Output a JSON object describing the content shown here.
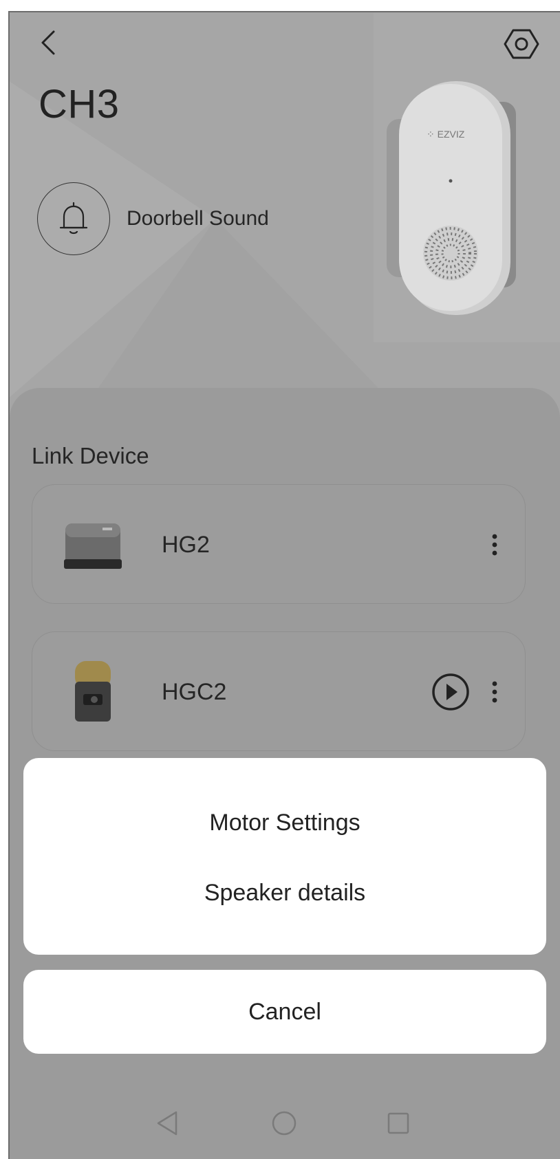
{
  "header": {
    "title": "CH3",
    "back_icon": "chevron-left-icon",
    "settings_icon": "hexagon-gear-icon"
  },
  "sound": {
    "label": "Doorbell Sound",
    "icon": "bell-icon"
  },
  "hero": {
    "brand_text": "EZVIZ"
  },
  "link_section": {
    "title": "Link Device",
    "devices": [
      {
        "name": "HG2",
        "has_play": false,
        "more_icon": "more-vertical-icon"
      },
      {
        "name": "HGC2",
        "has_play": true,
        "play_icon": "play-circle-icon",
        "more_icon": "more-vertical-icon"
      }
    ]
  },
  "action_sheet": {
    "items": [
      "Motor Settings",
      "Speaker details"
    ],
    "cancel_label": "Cancel"
  },
  "nav": {
    "back_icon": "triangle-back-icon",
    "home_icon": "circle-home-icon",
    "recents_icon": "square-recents-icon"
  },
  "colors": {
    "overlay_bg": "#a6a6a6",
    "sheet_bg": "#ffffff",
    "text": "#222222"
  }
}
